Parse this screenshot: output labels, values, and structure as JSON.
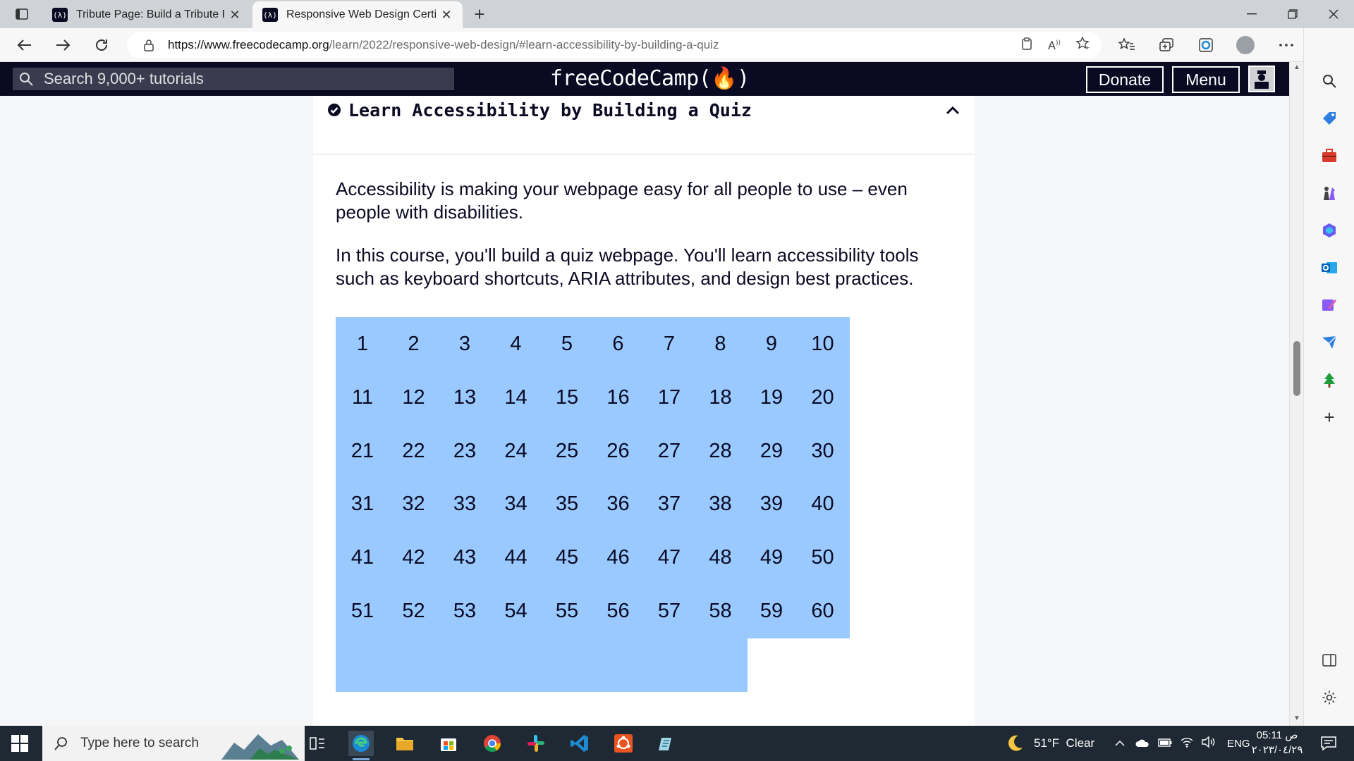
{
  "browser": {
    "tabs": [
      {
        "title": "Tribute Page: Build a Tribute Page",
        "icon": "freecodecamp-favicon"
      },
      {
        "title": "Responsive Web Design Certification",
        "icon": "freecodecamp-favicon"
      }
    ],
    "new_tab_label": "+",
    "url_host": "https://www.freecodecamp.org",
    "url_path": "/learn/2022/responsive-web-design/#learn-accessibility-by-building-a-quiz",
    "window_controls": [
      "minimize",
      "maximize",
      "close"
    ]
  },
  "fcc_nav": {
    "search_placeholder": "Search 9,000+ tutorials",
    "logo_text": "freeCodeCamp(🔥)",
    "donate_label": "Donate",
    "menu_label": "Menu"
  },
  "block": {
    "title": "Learn Accessibility by Building a Quiz",
    "description_1": "Accessibility is making your webpage easy for all people to use – even people with disabilities.",
    "description_2": "In this course, you'll build a quiz webpage. You'll learn accessibility tools such as keyboard shortcuts, ARIA attributes, and design best practices.",
    "visible_step_count": 68,
    "accent_color": "#99c9ff"
  },
  "taskbar": {
    "search_placeholder": "Type here to search",
    "weather": "51°F  Clear",
    "language": "ENG",
    "time": "05:11 ص",
    "date": "٢٠٢٣/٠٤/٢٩"
  },
  "colors": {
    "fcc_nav_bg": "#0a0a23",
    "step_bg": "#99c9ff",
    "taskbar_bg": "#1f2933"
  }
}
